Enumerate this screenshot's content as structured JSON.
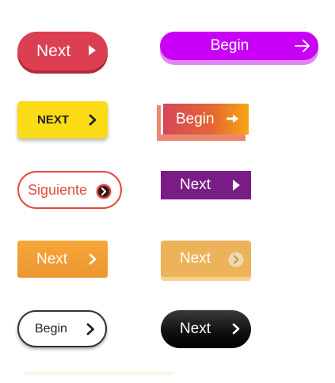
{
  "buttons": {
    "red_pill": {
      "label": "Next",
      "icon": "play-triangle-icon",
      "color": "#dc3f52"
    },
    "purple_pill": {
      "label": "Begin",
      "icon": "arrow-right-icon",
      "color": "#c800f5"
    },
    "yellow": {
      "label": "NEXT",
      "icon": "chevron-right-icon",
      "color": "#fadb16"
    },
    "gradient": {
      "label": "Begin",
      "icon": "arrow-right-icon",
      "color": "#e46434"
    },
    "outline_red": {
      "label": "Siguiente",
      "icon": "chevron-circle-right-icon",
      "color": "#e24a3a"
    },
    "violet": {
      "label": "Next",
      "icon": "play-triangle-icon",
      "color": "#7a1c86"
    },
    "orange": {
      "label": "Next",
      "icon": "chevron-right-icon",
      "color": "#f6a739"
    },
    "peach": {
      "label": "Next",
      "icon": "chevron-circle-right-icon",
      "color": "#ecb35a"
    },
    "outline_dark": {
      "label": "Begin",
      "icon": "chevron-right-icon",
      "color": "#333333"
    },
    "black_pill": {
      "label": "Next",
      "icon": "chevron-right-icon",
      "color": "#111111"
    }
  }
}
